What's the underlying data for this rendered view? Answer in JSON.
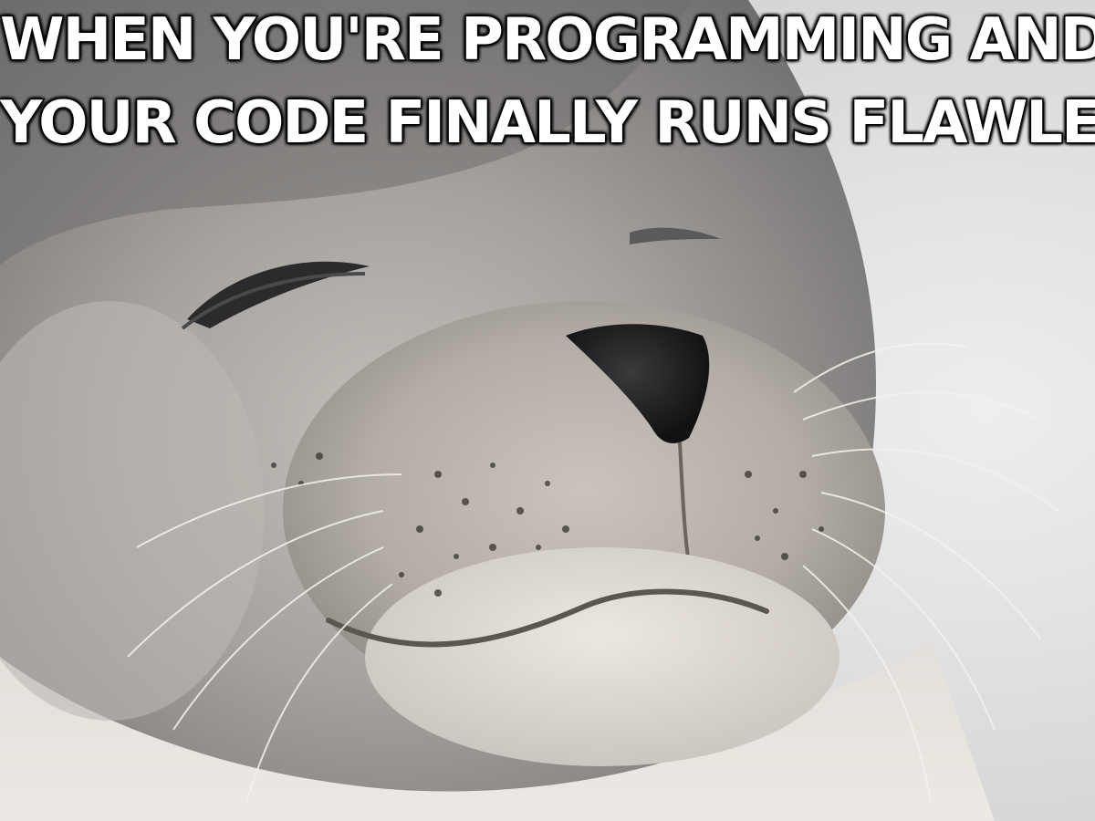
{
  "meme": {
    "caption": {
      "line1": "WHEN YOU'RE PROGRAMMING AND",
      "line2": "YOUR CODE FINALLY RUNS FLAWLESSLY"
    },
    "subject": "satisfied-seal",
    "colors": {
      "caption_fill": "#ffffff",
      "caption_stroke": "#000000",
      "fur_light": "#e4e0da",
      "fur_dark": "#6f6e6e",
      "background": "#e3e3e5"
    }
  }
}
